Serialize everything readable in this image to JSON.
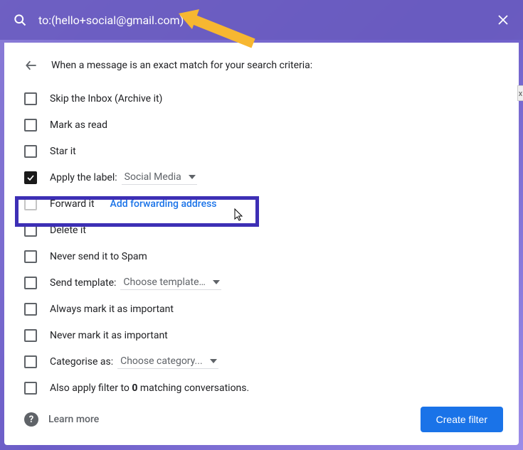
{
  "search": {
    "query": "to:(hello+social@gmail.com)"
  },
  "header": {
    "title": "When a message is an exact match for your search criteria:"
  },
  "options": {
    "skip_inbox": "Skip the Inbox (Archive it)",
    "mark_read": "Mark as read",
    "star_it": "Star it",
    "apply_label_prefix": "Apply the label:",
    "apply_label_value": "Social Media",
    "forward_it": "Forward it",
    "forward_link": "Add forwarding address",
    "delete_it": "Delete it",
    "never_spam": "Never send it to Spam",
    "send_template_prefix": "Send template:",
    "send_template_value": "Choose template…",
    "always_important": "Always mark it as important",
    "never_important": "Never mark it as important",
    "categorise_prefix": "Categorise as:",
    "categorise_value": "Choose category...",
    "also_apply_prefix": "Also apply filter to ",
    "also_apply_count": "0",
    "also_apply_suffix": " matching conversations."
  },
  "footer": {
    "learn_more": "Learn more",
    "create_filter": "Create filter"
  }
}
